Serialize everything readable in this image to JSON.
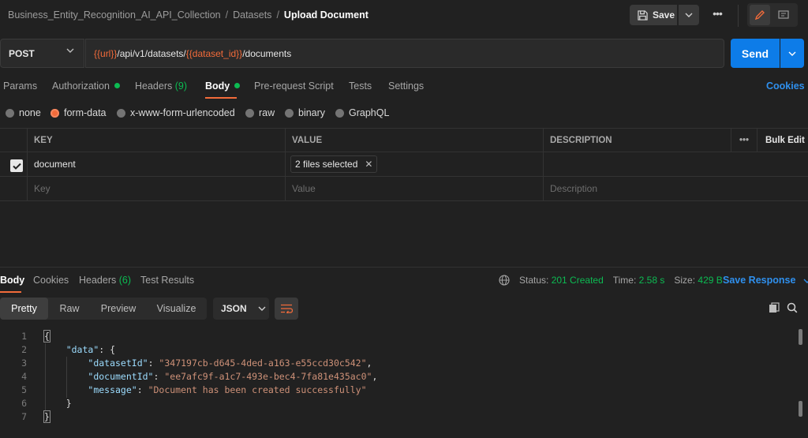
{
  "breadcrumb": {
    "collection": "Business_Entity_Recognition_AI_API_Collection",
    "folder": "Datasets",
    "current": "Upload Document",
    "separator": "/"
  },
  "toolbar": {
    "save_label": "Save",
    "more_label": "•••"
  },
  "request": {
    "method": "POST",
    "url_parts": [
      {
        "text": "{{url}}",
        "kind": "var"
      },
      {
        "text": "/api/v1/datasets/",
        "kind": "plain"
      },
      {
        "text": "{{dataset_id}}",
        "kind": "var"
      },
      {
        "text": "/documents",
        "kind": "plain"
      }
    ],
    "send_label": "Send"
  },
  "request_tabs": {
    "params": "Params",
    "authorization": "Authorization",
    "headers": "Headers",
    "headers_count": "(9)",
    "body": "Body",
    "pre_request": "Pre-request Script",
    "tests": "Tests",
    "settings": "Settings",
    "cookies": "Cookies",
    "active": "Body"
  },
  "body_types": {
    "none": "none",
    "form_data": "form-data",
    "urlencoded": "x-www-form-urlencoded",
    "raw": "raw",
    "binary": "binary",
    "graphql": "GraphQL",
    "selected": "form-data"
  },
  "form_table": {
    "headers": {
      "key": "KEY",
      "value": "VALUE",
      "description": "DESCRIPTION",
      "more": "•••",
      "bulk_edit": "Bulk Edit"
    },
    "rows": [
      {
        "checked": true,
        "key": "document",
        "value": "2 files selected",
        "description": ""
      }
    ],
    "placeholders": {
      "key": "Key",
      "value": "Value",
      "description": "Description"
    }
  },
  "response_tabs": {
    "body": "Body",
    "cookies": "Cookies",
    "headers": "Headers",
    "headers_count": "(6)",
    "test_results": "Test Results",
    "active": "Body"
  },
  "response_meta": {
    "status_label": "Status:",
    "status_value": "201 Created",
    "time_label": "Time:",
    "time_value": "2.58 s",
    "size_label": "Size:",
    "size_value": "429 B",
    "save_response": "Save Response"
  },
  "format_bar": {
    "pretty": "Pretty",
    "raw": "Raw",
    "preview": "Preview",
    "visualize": "Visualize",
    "format": "JSON",
    "active": "Pretty"
  },
  "response_body": {
    "line_numbers": [
      "1",
      "2",
      "3",
      "4",
      "5",
      "6",
      "7"
    ],
    "data_key": "\"data\"",
    "fields": [
      {
        "key": "\"datasetId\"",
        "value": "\"347197cb-d645-4ded-a163-e55ccd30c542\""
      },
      {
        "key": "\"documentId\"",
        "value": "\"ee7afc9f-a1c7-493e-bec4-7fa81e435ac0\""
      },
      {
        "key": "\"message\"",
        "value": "\"Document has been created successfully\""
      }
    ]
  },
  "colors": {
    "accent_orange": "#f26b3a",
    "send_blue": "#0d7ce8",
    "link_blue": "#2f90ee",
    "success_green": "#0cbb52",
    "background": "#212121"
  }
}
